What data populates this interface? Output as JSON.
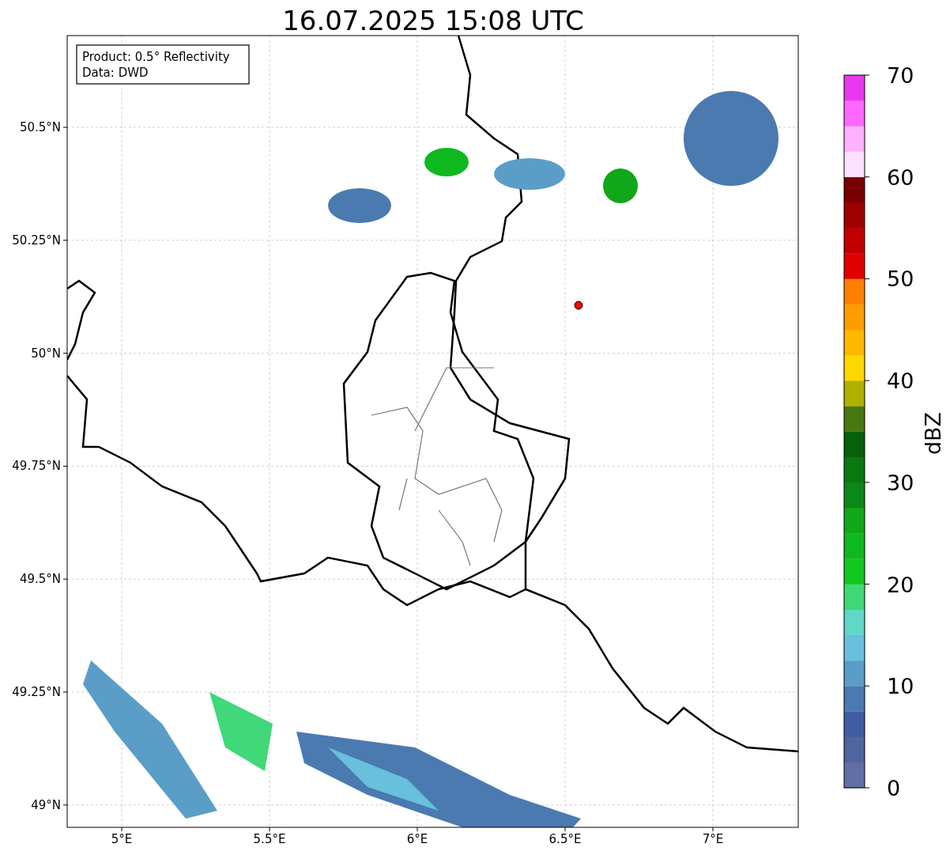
{
  "title": "16.07.2025 15:08 UTC",
  "info_box": [
    "Product: 0.5° Reflectivity",
    "Data: DWD"
  ],
  "x_ticks": [
    "5°E",
    "5.5°E",
    "6°E",
    "6.5°E",
    "7°E"
  ],
  "y_ticks": [
    "50.5°N",
    "50.25°N",
    "50°N",
    "49.75°N",
    "49.5°N",
    "49.25°N",
    "49°N"
  ],
  "colorbar": {
    "label": "dBZ",
    "ticks": [
      "70",
      "60",
      "50",
      "40",
      "30",
      "20",
      "10",
      "0"
    ],
    "bins": [
      {
        "color": "#6070a4"
      },
      {
        "color": "#50649e"
      },
      {
        "color": "#415ca0"
      },
      {
        "color": "#4a7ab0"
      },
      {
        "color": "#5a9ec8"
      },
      {
        "color": "#68c0dc"
      },
      {
        "color": "#60d8c8"
      },
      {
        "color": "#40d878"
      },
      {
        "color": "#10c820"
      },
      {
        "color": "#10b820"
      },
      {
        "color": "#10a818"
      },
      {
        "color": "#0c8818"
      },
      {
        "color": "#0a7810"
      },
      {
        "color": "#08600c"
      },
      {
        "color": "#487810"
      },
      {
        "color": "#b0b000"
      },
      {
        "color": "#ffd800"
      },
      {
        "color": "#ffb800"
      },
      {
        "color": "#ff9c00"
      },
      {
        "color": "#ff8000"
      },
      {
        "color": "#e00000"
      },
      {
        "color": "#c00000"
      },
      {
        "color": "#a00000"
      },
      {
        "color": "#780000"
      },
      {
        "color": "#ffe0ff"
      },
      {
        "color": "#ffb0ff"
      },
      {
        "color": "#ff66ff"
      },
      {
        "color": "#e838f0"
      }
    ]
  }
}
